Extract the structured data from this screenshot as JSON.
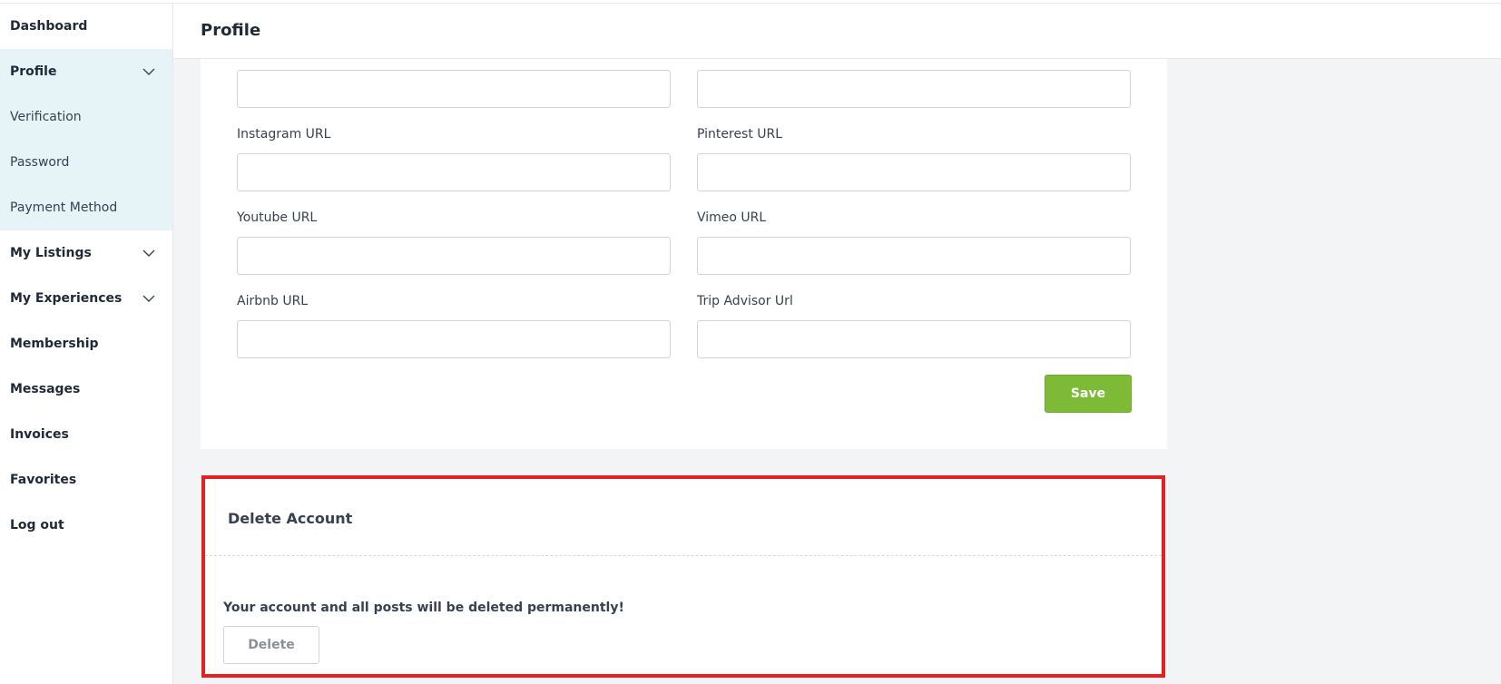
{
  "sidebar": {
    "items": [
      {
        "label": "Dashboard"
      },
      {
        "label": "Profile"
      },
      {
        "label": "Verification"
      },
      {
        "label": "Password"
      },
      {
        "label": "Payment Method"
      },
      {
        "label": "My Listings"
      },
      {
        "label": "My Experiences"
      },
      {
        "label": "Membership"
      },
      {
        "label": "Messages"
      },
      {
        "label": "Invoices"
      },
      {
        "label": "Favorites"
      },
      {
        "label": "Log out"
      }
    ]
  },
  "header": {
    "title": "Profile"
  },
  "form": {
    "fields": [
      {
        "label": "",
        "value": "",
        "placeholder": ""
      },
      {
        "label": "",
        "value": "",
        "placeholder": ""
      },
      {
        "label": "Instagram URL",
        "value": "",
        "placeholder": ""
      },
      {
        "label": "Pinterest URL",
        "value": "",
        "placeholder": ""
      },
      {
        "label": "Youtube URL",
        "value": "",
        "placeholder": ""
      },
      {
        "label": "Vimeo URL",
        "value": "",
        "placeholder": ""
      },
      {
        "label": "Airbnb URL",
        "value": "",
        "placeholder": ""
      },
      {
        "label": "Trip Advisor Url",
        "value": "",
        "placeholder": ""
      }
    ],
    "save_label": "Save"
  },
  "delete_account": {
    "title": "Delete Account",
    "message": "Your account and all posts will be deleted permanently!",
    "button_label": "Delete"
  },
  "colors": {
    "accent_green": "#7dbb37",
    "highlight_red": "#e42020",
    "sidebar_active_bg": "#e6f4f8"
  },
  "icons": {
    "profile_toggle": "chevron-down-icon",
    "listings_toggle": "chevron-down-icon",
    "experiences_toggle": "chevron-down-icon"
  }
}
